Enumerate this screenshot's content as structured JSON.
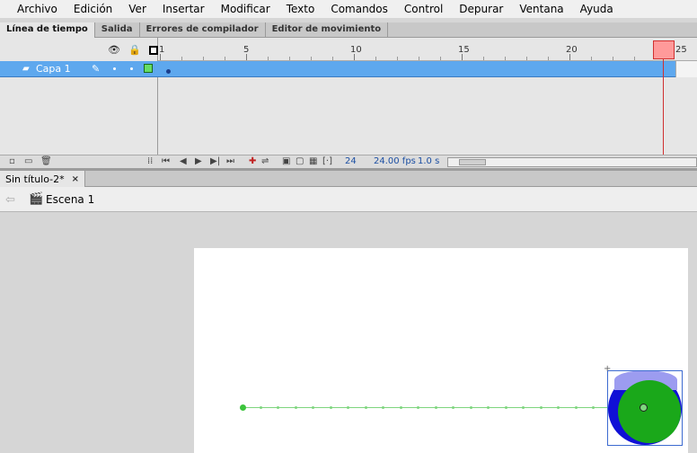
{
  "menu": [
    "Archivo",
    "Edición",
    "Ver",
    "Insertar",
    "Modificar",
    "Texto",
    "Comandos",
    "Control",
    "Depurar",
    "Ventana",
    "Ayuda"
  ],
  "panel_tabs": [
    "Línea de tiempo",
    "Salida",
    "Errores de compilador",
    "Editor de movimiento"
  ],
  "timeline": {
    "ruler_labels": [
      "1",
      "5",
      "10",
      "15",
      "20",
      "25"
    ],
    "current_frame_marker": "25",
    "layer": {
      "name": "Capa 1"
    },
    "status": {
      "frame": "24",
      "fps": "24.00 fps",
      "time": "1.0 s"
    },
    "layer_color": "#66dd66",
    "selection_color": "#5ea8ee",
    "playhead_color": "#ff9a9a"
  },
  "document": {
    "tab_title": "Sin título-2*",
    "close_glyph": "×"
  },
  "scene": {
    "name": "Escena 1"
  },
  "stage": {
    "background": "#ffffff",
    "shape_colors": {
      "outer": "#1010d6",
      "inner": "#1aa81a",
      "highlight": "#9c9cf0",
      "motion_path": "#7ed57e"
    }
  }
}
